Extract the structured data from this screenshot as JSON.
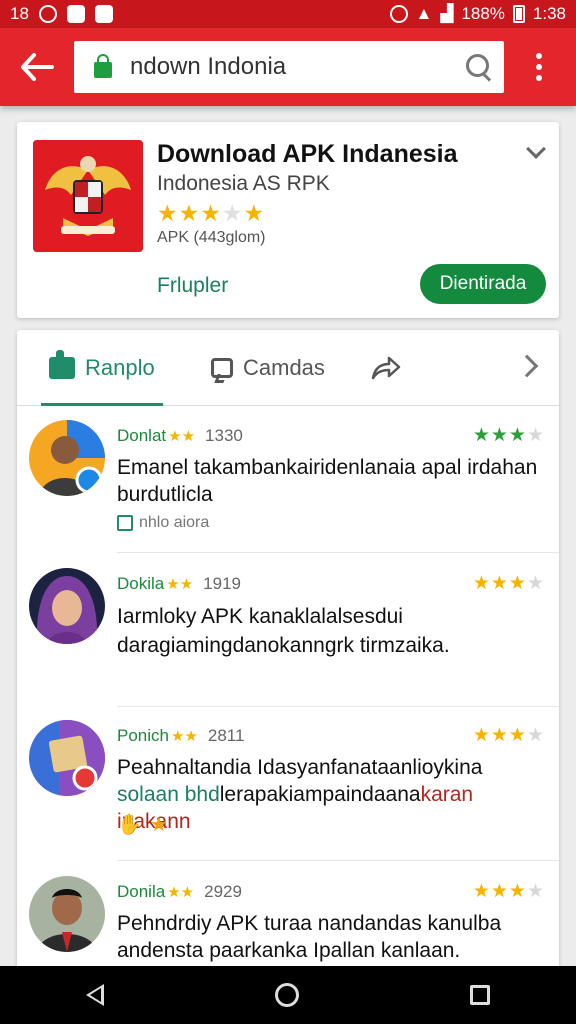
{
  "status_bar": {
    "time": "1:38",
    "left_text": "18",
    "battery": "188%"
  },
  "toolbar": {
    "search_value": "ndown Indonia"
  },
  "app": {
    "title": "Download APK Indanesia",
    "subtitle": "Indonesia AS RPK",
    "meta": "APK (443glom)",
    "link_label": "Frlupler",
    "install_label": "Dientirada",
    "rating_stars": 3,
    "colors": {
      "icon_bg": "#e11b22",
      "install": "#138a3e"
    }
  },
  "tabs": [
    {
      "label": "Ranplo",
      "icon": "reviews-icon"
    },
    {
      "label": "Camdas",
      "icon": "comment-icon"
    },
    {
      "label": "",
      "icon": "share-icon"
    }
  ],
  "reviews": [
    {
      "name": "Donlat",
      "date": "1330",
      "text": "Emanel takambankairidenlanaia apal irdahan burdutlicla",
      "extra": "nhlo aiora",
      "rating": 2.5,
      "star_color": "green"
    },
    {
      "name": "Dokila",
      "date": "1919",
      "text": "Iarmloky APK kanaklalalsesdui daragiamingdanokanngrk tirmzaika.",
      "rating": 2.5,
      "star_color": "gold"
    },
    {
      "name": "Ponich",
      "date": "2811",
      "text_main": "Peahnaltandia Idasyanfanataanlioykina",
      "text_green": "solaan bhd",
      "text_mid": "lerapakiampaindaana",
      "text_red": "karan inakann",
      "rating": 3,
      "star_color": "gold"
    },
    {
      "name": "Donila",
      "date": "2929",
      "text": "Pehndrdiy APK turaa nandandas kanulba andensta paarkanka Ipallan kanlaan.",
      "rating": 2.5,
      "star_color": "gold"
    }
  ]
}
